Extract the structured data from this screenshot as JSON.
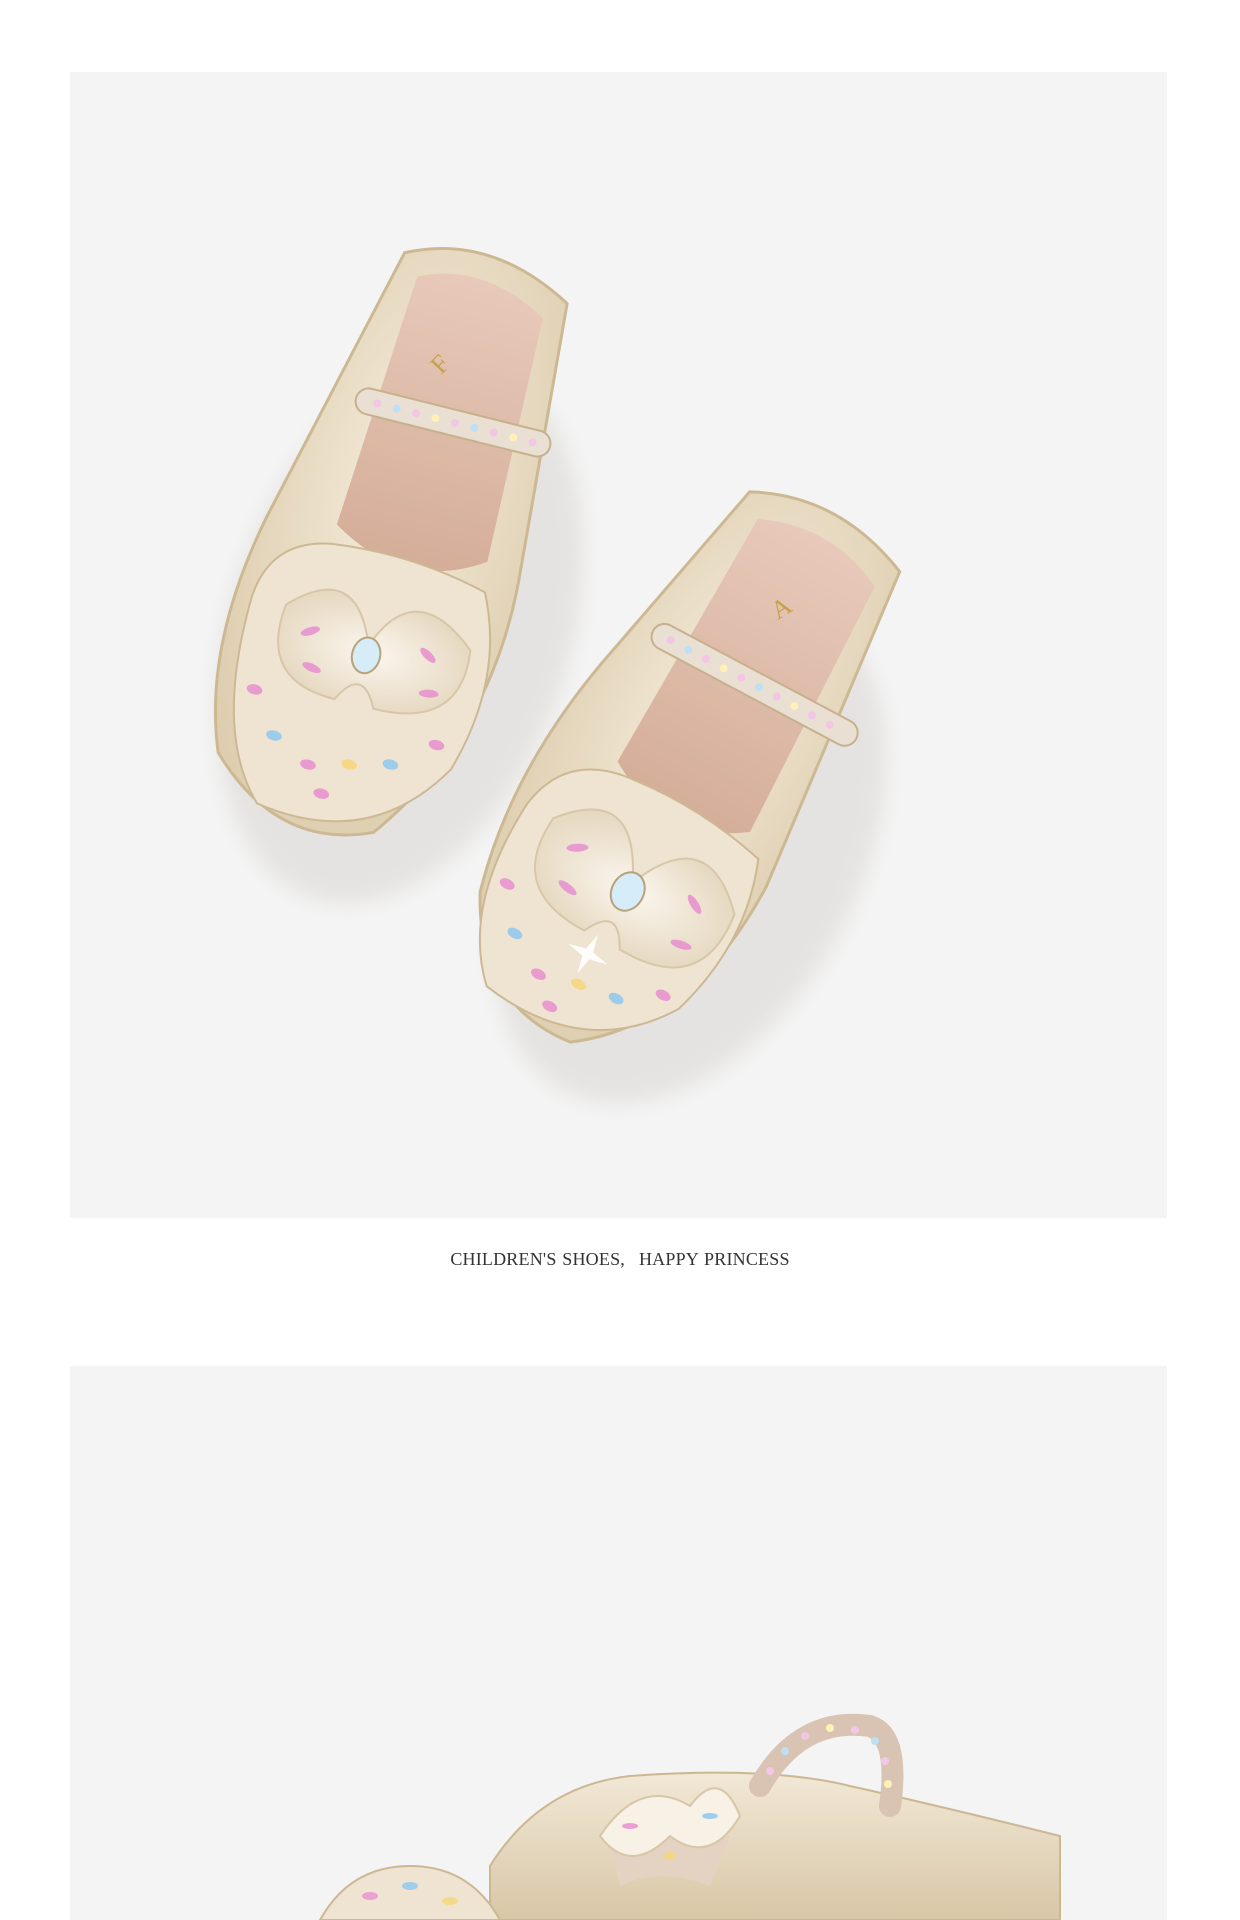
{
  "caption": {
    "part1": "CHILDREN'S SHOES,",
    "part2": "HAPPY PRINCESS"
  },
  "insole_brand_marks": {
    "left_shoe": "F",
    "right_shoe": "A"
  },
  "colors": {
    "page_background": "#ffffff",
    "panel_background": "#f4f4f4",
    "caption_text": "#333333",
    "shoe_champagne": "#e9dcc4",
    "insole_pink": "#dcb8a6",
    "iridescent_pink": "#e88fd0",
    "iridescent_blue": "#8fc8f0"
  }
}
